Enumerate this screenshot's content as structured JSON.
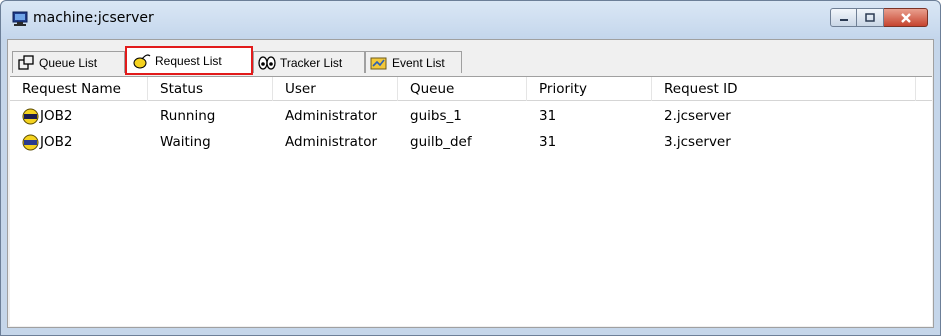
{
  "window": {
    "title": "machine:jcserver",
    "icon": "computer-icon"
  },
  "tabs": [
    {
      "label": "Queue List",
      "icon": "queue-icon",
      "active": false
    },
    {
      "label": "Request List",
      "icon": "request-icon",
      "active": true
    },
    {
      "label": "Tracker List",
      "icon": "tracker-icon",
      "active": false
    },
    {
      "label": "Event List",
      "icon": "event-icon",
      "active": false
    }
  ],
  "columns": [
    "Request Name",
    "Status",
    "User",
    "Queue",
    "Priority",
    "Request ID"
  ],
  "rows": [
    {
      "icon_text": "Run",
      "name": "JOB2",
      "status": "Running",
      "user": "Administrator",
      "queue": "guibs_1",
      "priority": "31",
      "request_id": "2.jcserver"
    },
    {
      "icon_text": "Wait",
      "name": "JOB2",
      "status": "Waiting",
      "user": "Administrator",
      "queue": "guilb_def",
      "priority": "31",
      "request_id": "3.jcserver"
    }
  ],
  "colors": {
    "active_tab_border": "#e21b1b",
    "status_icon": "#f4d21f"
  }
}
